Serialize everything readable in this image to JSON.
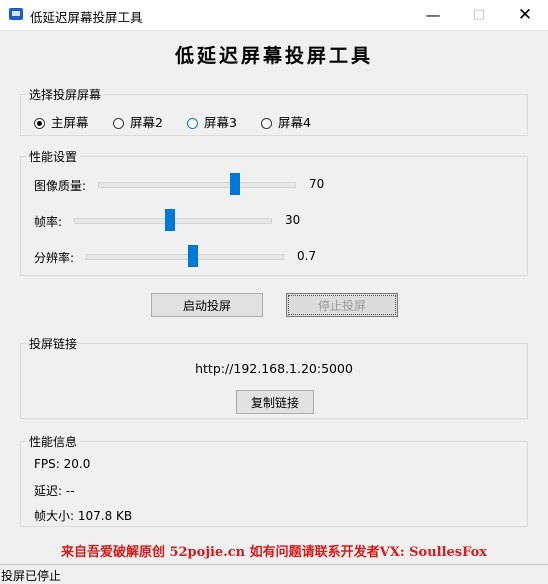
{
  "window": {
    "title": "低延迟屏幕投屏工具"
  },
  "heading": "低延迟屏幕投屏工具",
  "screen_select": {
    "title": "选择投屏屏幕",
    "options": [
      {
        "label": "主屏幕",
        "selected": true
      },
      {
        "label": "屏幕2",
        "selected": false
      },
      {
        "label": "屏幕3",
        "selected": false
      },
      {
        "label": "屏幕4",
        "selected": false
      }
    ]
  },
  "performance": {
    "title": "性能设置",
    "image_quality": {
      "label": "图像质量:",
      "value": "70",
      "min": 1,
      "max": 100
    },
    "frame_rate": {
      "label": "帧率:",
      "value": "30",
      "min": 1,
      "max": 60
    },
    "resolution": {
      "label": "分辨率:",
      "value": "0.7",
      "min": 0.1,
      "max": 1.2
    }
  },
  "buttons": {
    "start": "启动投屏",
    "stop": "停止投屏"
  },
  "link": {
    "title": "投屏链接",
    "url": "http://192.168.1.20:5000",
    "copy": "复制链接"
  },
  "info": {
    "title": "性能信息",
    "fps": "FPS: 20.0",
    "latency": "延迟: --",
    "frame_size": "帧大小: 107.8 KB"
  },
  "credit": "来自吾爱破解原创 52pojie.cn 如有问题请联系开发者VX: SoullesFox",
  "status": "投屏已停止"
}
